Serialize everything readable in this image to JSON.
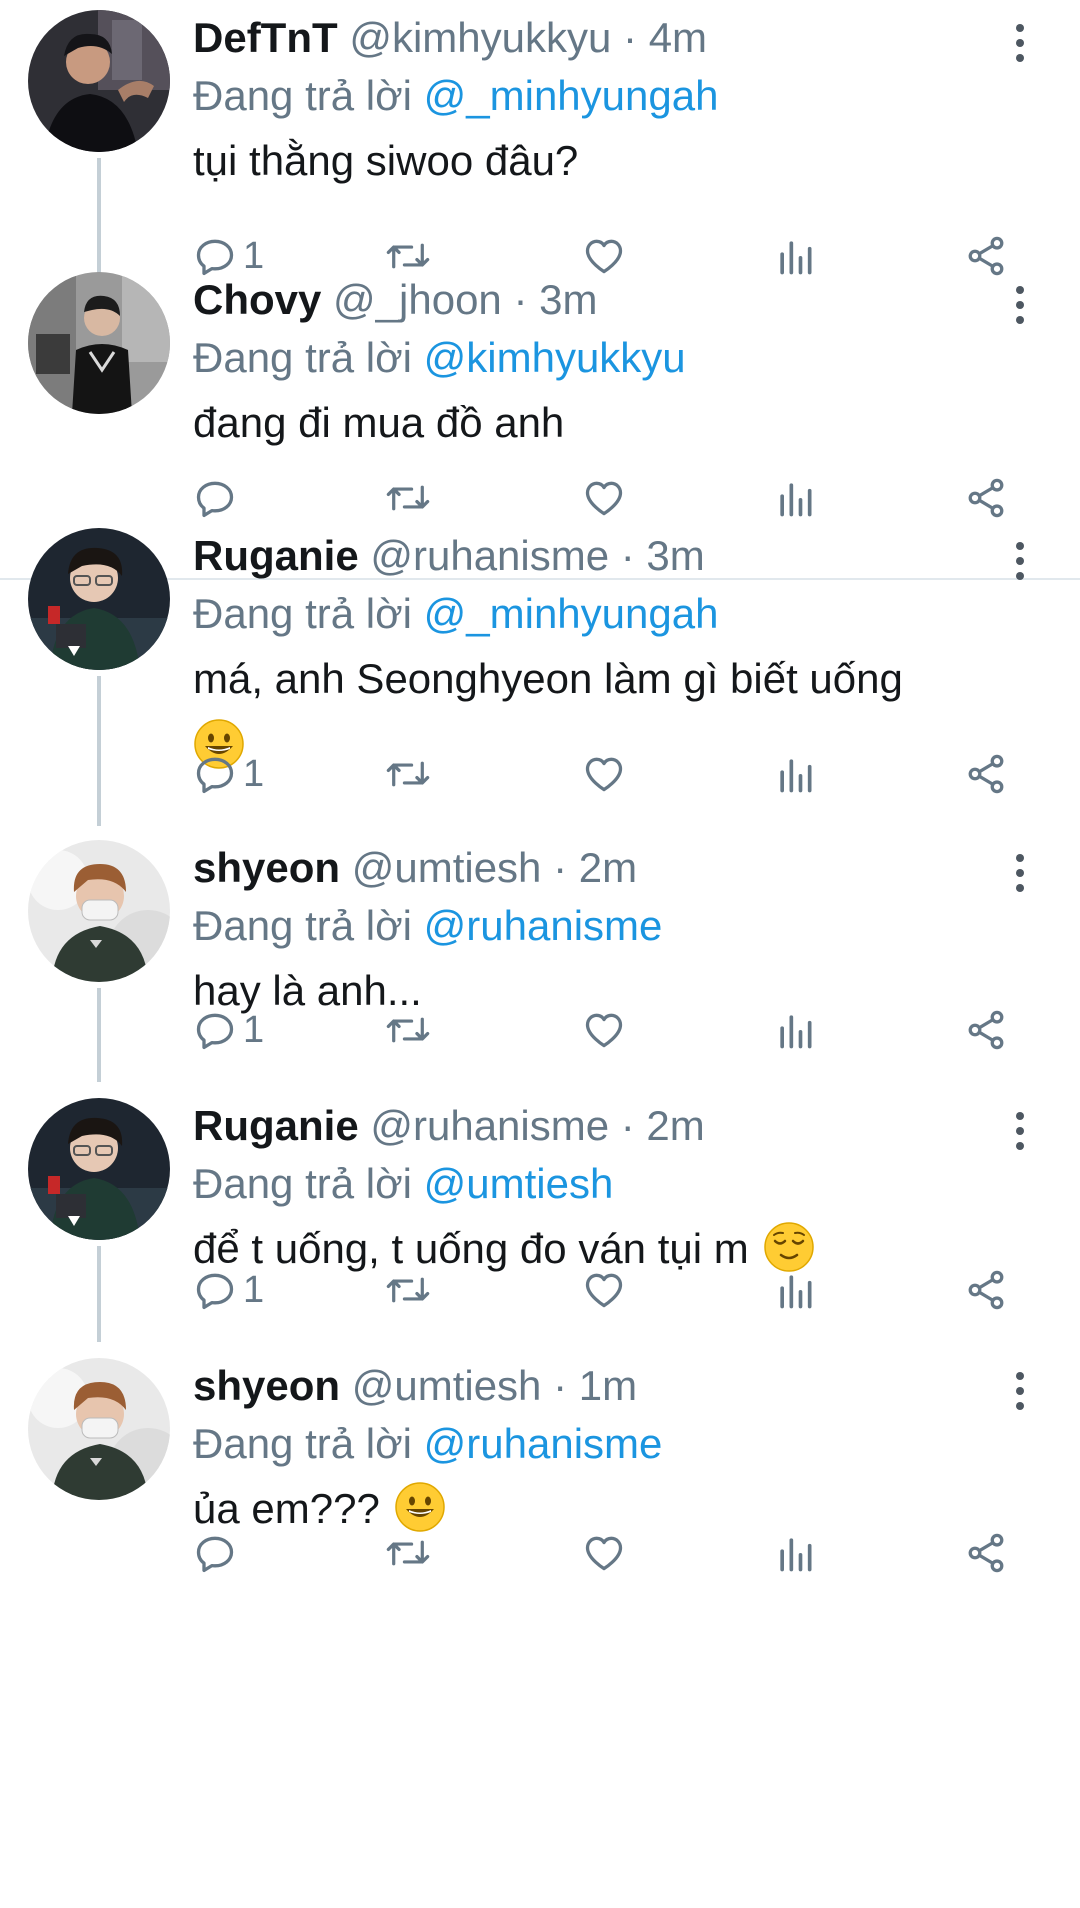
{
  "reply_prefix": "Đang trả lời",
  "tweets": [
    {
      "name": "DefTnT",
      "handle": "@kimhyukkyu",
      "time": "4m",
      "reply_to": "@_minhyungah",
      "text": "tụi thằng siwoo đâu?",
      "emoji": "",
      "reply_count": "1"
    },
    {
      "name": "Chovy",
      "handle": "@_jhoon",
      "time": "3m",
      "reply_to": "@kimhyukkyu",
      "text": "đang đi mua đồ anh",
      "emoji": "",
      "reply_count": ""
    },
    {
      "name": "Ruganie",
      "handle": "@ruhanisme",
      "time": "3m",
      "reply_to": "@_minhyungah",
      "text": "má, anh Seonghyeon làm gì biết uống",
      "emoji": "grinning-face-emoji",
      "reply_count": "1"
    },
    {
      "name": "shyeon",
      "handle": "@umtiesh",
      "time": "2m",
      "reply_to": "@ruhanisme",
      "text": "hay là anh...",
      "emoji": "",
      "reply_count": "1"
    },
    {
      "name": "Ruganie",
      "handle": "@ruhanisme",
      "time": "2m",
      "reply_to": "@umtiesh",
      "text": "để t uống, t uống đo ván tụi m",
      "emoji": "relieved-face-emoji",
      "reply_count": "1"
    },
    {
      "name": "shyeon",
      "handle": "@umtiesh",
      "time": "1m",
      "reply_to": "@ruhanisme",
      "text": "ủa em???",
      "emoji": "grinning-face-emoji",
      "reply_count": ""
    }
  ],
  "colors": {
    "accent_link": "#1b95e0",
    "secondary_text": "#657786",
    "primary_text": "#14171a",
    "thread_line": "#c4cfd6",
    "divider": "#e1e8ed"
  },
  "icons": {
    "reply": "reply-icon",
    "retweet": "retweet-icon",
    "like": "heart-icon",
    "analytics": "analytics-icon",
    "share": "share-icon",
    "more": "more-vertical-icon"
  }
}
